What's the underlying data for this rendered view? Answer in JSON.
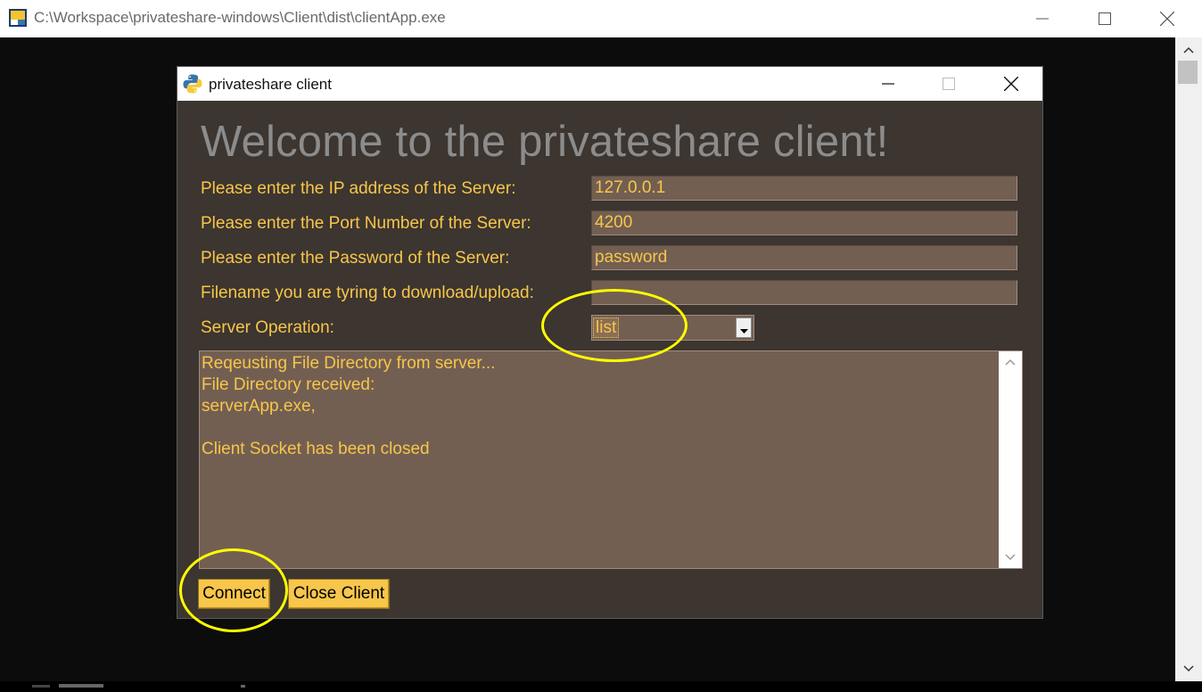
{
  "outer_window": {
    "title": "C:\\Workspace\\privateshare-windows\\Client\\dist\\clientApp.exe",
    "icon": "console-app-icon",
    "controls": [
      "minimize-icon",
      "maximize-icon",
      "close-icon"
    ]
  },
  "inner_window": {
    "title": "privateshare client",
    "icon": "python-icon",
    "controls": [
      "minimize-icon",
      "maximize-icon",
      "close-icon"
    ]
  },
  "form": {
    "heading": "Welcome to the privateshare client!",
    "ip_label": "Please enter the IP address of the Server:",
    "ip_value": "127.0.0.1",
    "port_label": "Please enter the Port Number of the Server:",
    "port_value": "4200",
    "password_label": "Please enter the Password of the Server:",
    "password_value": "password",
    "filename_label": "Filename you are tyring to download/upload:",
    "filename_value": "",
    "operation_label": "Server Operation:",
    "operation_value": "list"
  },
  "output": {
    "text": "Reqeusting File Directory from server...\nFile Directory received:\nserverApp.exe,\n\nClient Socket has been closed"
  },
  "buttons": {
    "connect": "Connect",
    "close_client": "Close Client"
  },
  "colors": {
    "background": "#3c3530",
    "field_bg": "#735f52",
    "text": "#f7c64a",
    "button": "#f7c64a",
    "heading": "#8c8c8c",
    "annotation": "#ffff00"
  }
}
